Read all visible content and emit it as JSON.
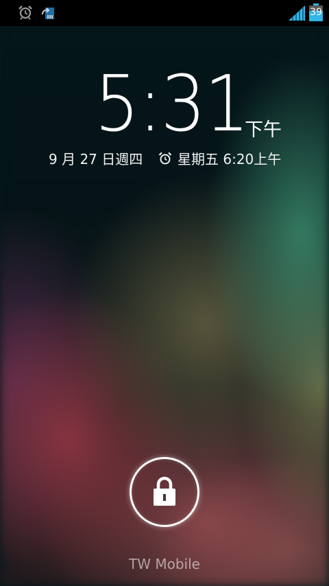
{
  "status_bar": {
    "icons": [
      "alarm-clock-icon",
      "sync-icon",
      "cell-signal-icon",
      "battery-icon"
    ],
    "battery_level": "39",
    "accent_color": "#33b5e5"
  },
  "clock": {
    "time": "5:31",
    "ampm": "下午"
  },
  "date": {
    "text": "9 月 27 日週四"
  },
  "next_alarm": {
    "icon": "alarm-clock-icon",
    "text": "星期五 6:20上午"
  },
  "unlock": {
    "icon": "padlock-icon"
  },
  "carrier": {
    "name": "TW Mobile"
  }
}
